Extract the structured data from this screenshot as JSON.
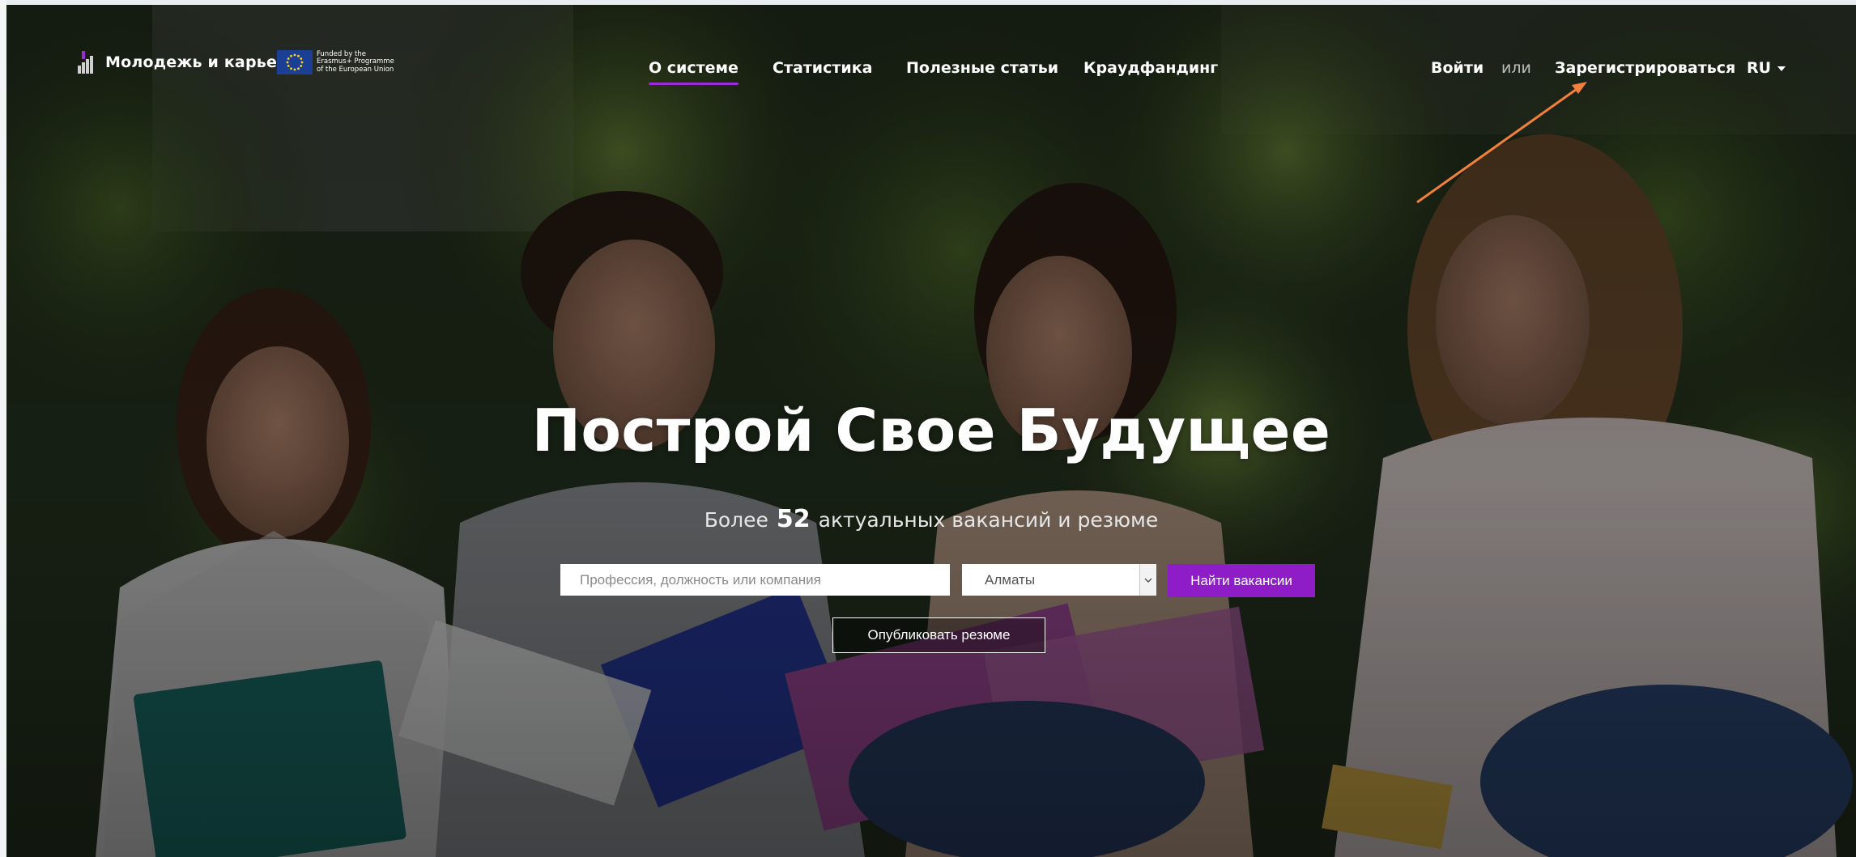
{
  "brand": {
    "name": "Молодежь и карьера",
    "eu_text_lines": [
      "Funded by the",
      "Erasmus+ Programme",
      "of the European Union"
    ]
  },
  "nav": {
    "items": [
      {
        "label": "О системе",
        "active": true
      },
      {
        "label": "Статистика",
        "active": false
      },
      {
        "label": "Полезные статьи",
        "active": false
      },
      {
        "label": "Краудфандинг",
        "active": false
      }
    ],
    "login": "Войти",
    "or": "или",
    "register": "Зарегистрироваться",
    "language": "RU"
  },
  "hero": {
    "headline": "Построй Свое Будущее",
    "sub_prefix": "Более",
    "vacancy_count": "52",
    "sub_suffix": "актуальных вакансий и резюме"
  },
  "search": {
    "placeholder": "Профессия, должность или компания",
    "city": "Алматы",
    "find_label": "Найти вакансии",
    "publish_label": "Опубликовать резюме"
  },
  "colors": {
    "accent": "#8e1dc7",
    "annotation_arrow": "#f0803c"
  }
}
